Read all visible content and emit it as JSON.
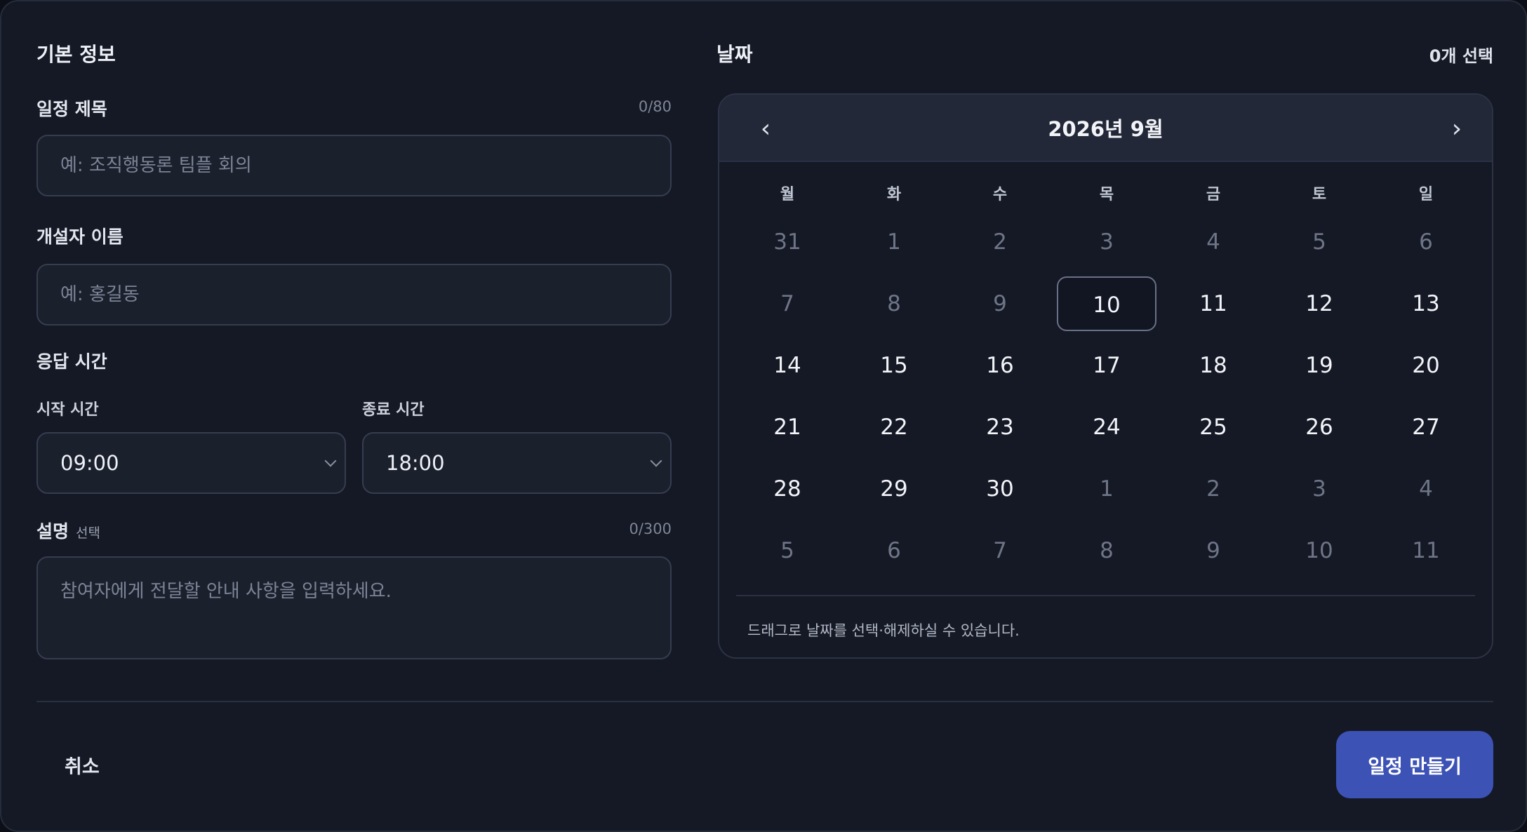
{
  "basic_info": {
    "section_title": "기본 정보",
    "title_field": {
      "label": "일정 제목",
      "counter": "0/80",
      "placeholder": "예: 조직행동론 팀플 회의",
      "value": ""
    },
    "host_field": {
      "label": "개설자 이름",
      "placeholder": "예: 홍길동",
      "value": ""
    },
    "response_time": {
      "label": "응답 시간",
      "start": {
        "label": "시작 시간",
        "value": "09:00"
      },
      "end": {
        "label": "종료 시간",
        "value": "18:00"
      }
    },
    "description": {
      "label": "설명",
      "optional": "선택",
      "counter": "0/300",
      "placeholder": "참여자에게 전달할 안내 사항을 입력하세요.",
      "value": ""
    }
  },
  "dates": {
    "section_title": "날짜",
    "selected_count": "0개 선택",
    "calendar": {
      "title": "2026년 9월",
      "prev": "‹",
      "next": "›",
      "weekdays": [
        "월",
        "화",
        "수",
        "목",
        "금",
        "토",
        "일"
      ],
      "weeks": [
        [
          {
            "d": "31",
            "m": true
          },
          {
            "d": "1",
            "m": true
          },
          {
            "d": "2",
            "m": true
          },
          {
            "d": "3",
            "m": true
          },
          {
            "d": "4",
            "m": true
          },
          {
            "d": "5",
            "m": true
          },
          {
            "d": "6",
            "m": true
          }
        ],
        [
          {
            "d": "7",
            "m": true
          },
          {
            "d": "8",
            "m": true
          },
          {
            "d": "9",
            "m": true
          },
          {
            "d": "10",
            "t": true
          },
          {
            "d": "11"
          },
          {
            "d": "12"
          },
          {
            "d": "13"
          }
        ],
        [
          {
            "d": "14"
          },
          {
            "d": "15"
          },
          {
            "d": "16"
          },
          {
            "d": "17"
          },
          {
            "d": "18"
          },
          {
            "d": "19"
          },
          {
            "d": "20"
          }
        ],
        [
          {
            "d": "21"
          },
          {
            "d": "22"
          },
          {
            "d": "23"
          },
          {
            "d": "24"
          },
          {
            "d": "25"
          },
          {
            "d": "26"
          },
          {
            "d": "27"
          }
        ],
        [
          {
            "d": "28"
          },
          {
            "d": "29"
          },
          {
            "d": "30"
          },
          {
            "d": "1",
            "m": true
          },
          {
            "d": "2",
            "m": true
          },
          {
            "d": "3",
            "m": true
          },
          {
            "d": "4",
            "m": true
          }
        ],
        [
          {
            "d": "5",
            "m": true
          },
          {
            "d": "6",
            "m": true
          },
          {
            "d": "7",
            "m": true
          },
          {
            "d": "8",
            "m": true
          },
          {
            "d": "9",
            "m": true
          },
          {
            "d": "10",
            "m": true
          },
          {
            "d": "11",
            "m": true
          }
        ]
      ],
      "hint": "드래그로 날짜를 선택·해제하실 수 있습니다."
    }
  },
  "footer": {
    "cancel_label": "취소",
    "create_label": "일정 만들기"
  },
  "colors": {
    "accent": "#3d52b5",
    "panel": "#151925"
  }
}
